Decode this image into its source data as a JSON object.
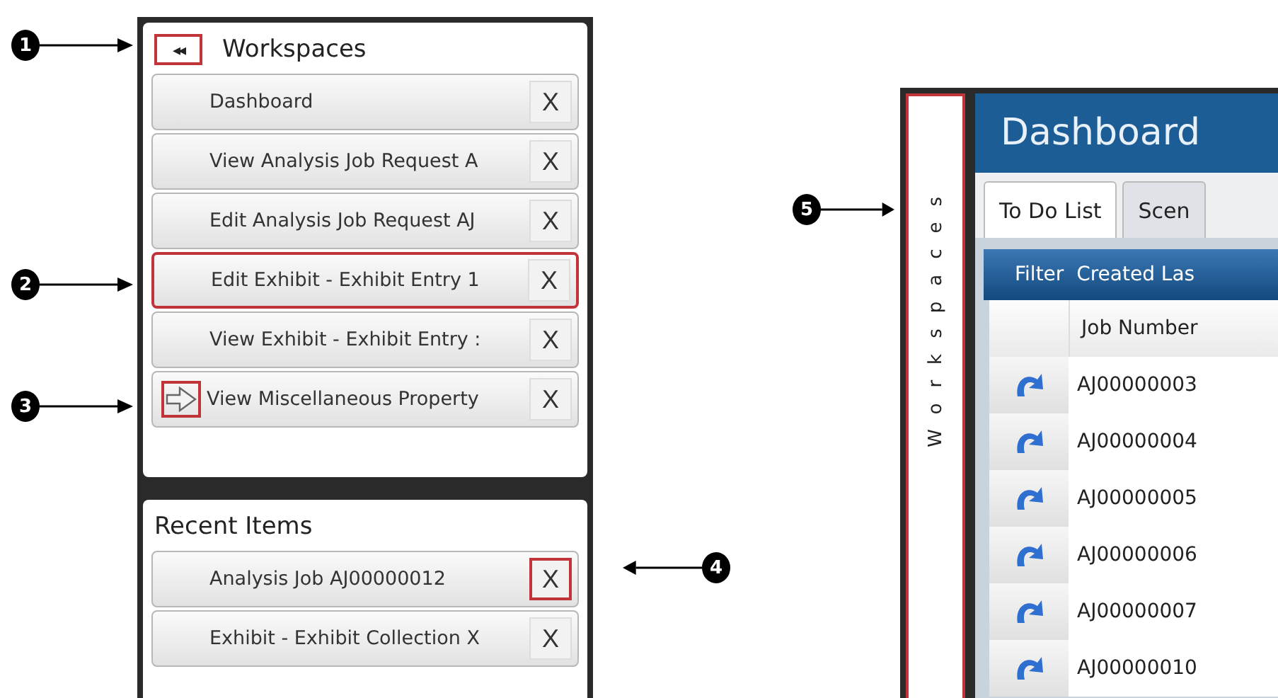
{
  "callouts": [
    "1",
    "2",
    "3",
    "4",
    "5"
  ],
  "workspaces": {
    "collapse_icon": "◂◂",
    "title": "Workspaces",
    "items": [
      {
        "label": "Dashboard",
        "close": "X",
        "highlighted": false,
        "current": false
      },
      {
        "label": "View Analysis Job Request A",
        "close": "X",
        "highlighted": false,
        "current": false
      },
      {
        "label": "Edit Analysis Job Request AJ",
        "close": "X",
        "highlighted": false,
        "current": false
      },
      {
        "label": "Edit Exhibit - Exhibit Entry 1",
        "close": "X",
        "highlighted": true,
        "current": false
      },
      {
        "label": "View Exhibit - Exhibit Entry :",
        "close": "X",
        "highlighted": false,
        "current": false
      },
      {
        "label": "View Miscellaneous Property",
        "close": "X",
        "highlighted": false,
        "current": true
      }
    ]
  },
  "recent": {
    "title": "Recent Items",
    "items": [
      {
        "label": "Analysis Job AJ00000012",
        "close": "X",
        "close_highlighted": true
      },
      {
        "label": "Exhibit - Exhibit Collection X",
        "close": "X",
        "close_highlighted": false
      }
    ]
  },
  "collapsed_view": {
    "strip_label": "Workspaces",
    "title": "Dashboard",
    "tabs": [
      {
        "label": "To Do List",
        "selected": true
      },
      {
        "label": "Scen",
        "selected": false
      }
    ],
    "filter": "Filter  Created Las",
    "columns": [
      "Job Number"
    ],
    "rows": [
      "AJ00000003",
      "AJ00000004",
      "AJ00000005",
      "AJ00000006",
      "AJ00000007",
      "AJ00000010"
    ]
  }
}
